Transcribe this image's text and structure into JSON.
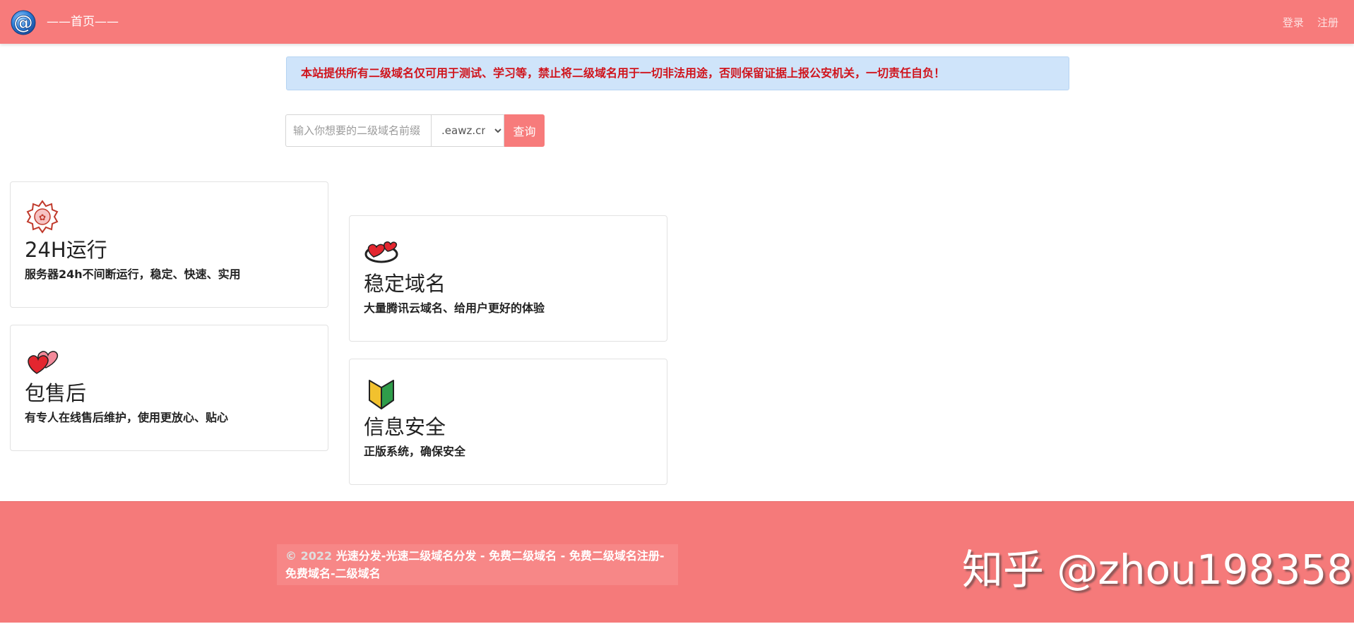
{
  "header": {
    "logo_icon": "at-sign-globe-icon",
    "brand": "——首页——",
    "login": "登录",
    "register": "注册",
    "bg_color": "#f77b7b"
  },
  "notice": {
    "text": "本站提供所有二级域名仅可用于测试、学习等，禁止将二级域名用于一切非法用途，否则保留证据上报公安机关，一切责任自负！",
    "color": "#d0141c"
  },
  "search": {
    "placeholder": "输入你想要的二级域名前缀",
    "suffix_selected": ".eawz.cn",
    "button": "查询"
  },
  "features": [
    {
      "icon": "cherry-blossom-badge-icon",
      "title": "24H运行",
      "desc": "服务器24h不间断运行，稳定、快速、实用"
    },
    {
      "icon": "revolving-hearts-icon",
      "title": "稳定域名",
      "desc": "大量腾讯云域名、给用户更好的体验"
    },
    {
      "icon": "two-hearts-icon",
      "title": "包售后",
      "desc": "有专人在线售后维护，使用更放心、贴心"
    },
    {
      "icon": "beginner-shield-icon",
      "title": "信息安全",
      "desc": "正版系统，确保安全"
    }
  ],
  "footer": {
    "year": "© 2022",
    "copyright": "光速分发-光速二级域名分发 - 免费二级域名 - 免费二级域名注册-免费域名-二级域名",
    "watermark": "知乎 @zhou198358"
  }
}
